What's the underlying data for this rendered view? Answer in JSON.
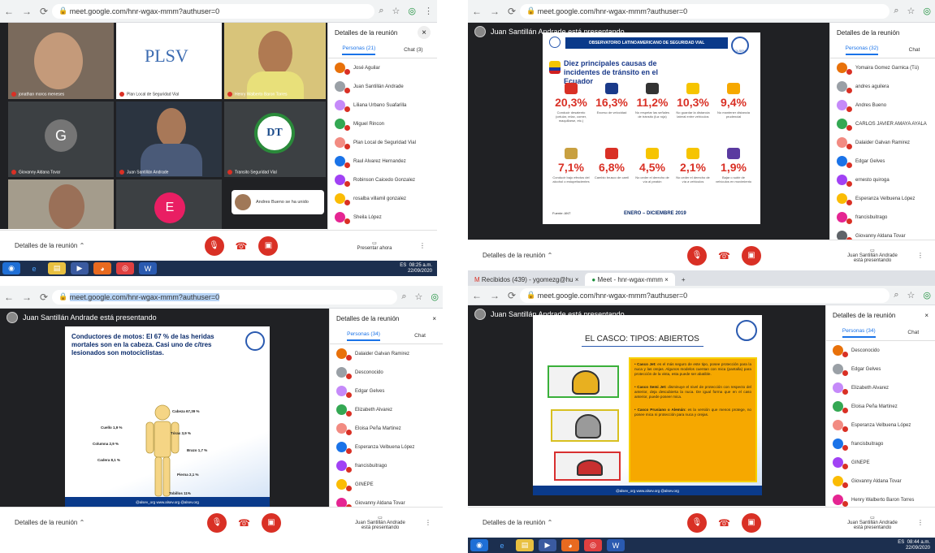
{
  "q1": {
    "url": "meet.google.com/hnr-wgax-mmm?authuser=0",
    "tiles": [
      "jonathan moros meneses",
      "Plan Local de Seguridad Vial",
      "Henry Walberto Baron Torres",
      "Giovanny Aldana Tovar",
      "Juan Santillán Andrade",
      "Transito Seguridad Vial"
    ],
    "plsv_logo": "PLSV",
    "g_letter": "G",
    "e_letter": "E",
    "dt_logo": "DT",
    "toast": "Andres Bueno se ha unido",
    "panel_title": "Detalles de la reunión",
    "people_tab": "Personas (21)",
    "chat_tab": "Chat (3)",
    "people": [
      "José Aguilar",
      "Juan Santillán Andrade",
      "Liliana Urbano Suafarilla",
      "Miguel Rincon",
      "Plan Local de Seguridad Vial",
      "Raul Alvarez Hernandez",
      "Robinson Caicedo Gonzalez",
      "rosalba villamil gonzalez",
      "Sheila López",
      "Transito Seguridad Vial"
    ],
    "meeting_details": "Detalles de la reunión",
    "present_label": "Presentar ahora",
    "lang": "ES",
    "time": "08:25 a.m.",
    "date": "22/09/2020"
  },
  "q2": {
    "url": "meet.google.com/hnr-wgax-mmm?authuser=0",
    "banner": "Juan Santillán Andrade está presentando",
    "slide_header": "OBSERVATORIO LATINOAMERICANO DE SEGURIDAD VIAL",
    "slide_title": "Diez principales causas de incidentes de tránsito en el Ecuador",
    "logo_text": "OLSEV",
    "percents_row1": [
      "20,3%",
      "16,3%",
      "11,2%",
      "10,3%",
      "9,4%"
    ],
    "captions_row1": [
      "Conducir desatento (celular, relax, comer, maquillarse, etc.)",
      "Exceso de velocidad",
      "No respetar las señales de tránsito (luz roja)",
      "No guardar la distancia lateral entre vehículos",
      "No mantener distancia prudencial"
    ],
    "percents_row2": [
      "7,1%",
      "6,8%",
      "4,5%",
      "2,1%",
      "1,9%"
    ],
    "captions_row2": [
      "Conducir bajo efectos del alcohol o estupefacientes",
      "Cambio brusco de carril",
      "No ceder el derecho de vía al peatón",
      "No ceder el derecho de vía a vehículos",
      "Bajar o subir de vehículos en movimiento"
    ],
    "source": "Fuente: ANT",
    "period": "ENERO – DICIEMBRE 2019",
    "panel_title": "Detalles de la reunión",
    "people_tab": "Personas (32)",
    "chat_tab": "Chat",
    "people": [
      "Yomaira Gomez Garnica (Tú)",
      "andres aguilera",
      "Andres Bueno",
      "CARLOS JAVIER AMAYA AYALA",
      "Dalaider Galvan Ramirez",
      "Edgar Gelves",
      "ernesto quiroga",
      "Esperanza Velbuena López",
      "francisbuitrago",
      "Giovanny Aldana Tovar"
    ],
    "meeting_details": "Detalles de la reunión",
    "presenting_label": "Juan Santillán Andrade está presentando"
  },
  "q3": {
    "url": "meet.google.com/hnr-wgax-mmm?authuser=0",
    "banner": "Juan Santillán Andrade está presentando",
    "slide_title": "Conductores de motos: El 67 % de las heridas mortales son en la cabeza. Casi uno de c/tres lesionados son motociclistas.",
    "body_labels": [
      "Cabeza 67,39 %",
      "Cuello 1,9 %",
      "Columna 2,9 %",
      "Tórax 3,9 %",
      "Brazo 1,7 %",
      "Cadera 8,1 %",
      "Pierna 2,1 %",
      "Tobillos 11%"
    ],
    "footer": "@alsev_org   www.alsev.org   @alsev.org",
    "panel_title": "Detalles de la reunión",
    "people_tab": "Personas (34)",
    "chat_tab": "Chat",
    "people": [
      "Dalaider Galvan Ramirez",
      "Desconocido",
      "Edgar Gelves",
      "Elizabeth Alvarez",
      "Eloisa Peña Martinez",
      "Esperanza Velbuena López",
      "francisbuitrago",
      "GINEPE",
      "Giovanny Aldana Tovar",
      "Henry Walberto Baron Torres"
    ],
    "meeting_details": "Detalles de la reunión",
    "presenting_label": "Juan Santillán Andrade está presentando"
  },
  "q4": {
    "tabs": [
      "Recibidos (439) - ygomezg@hu",
      "Meet - hnr-wgax-mmm"
    ],
    "url": "meet.google.com/hnr-wgax-mmm?authuser=0",
    "banner": "Juan Santillán Andrade está presentando",
    "slide_title": "EL CASCO: TIPOS: ABIERTOS",
    "bullets": [
      "Casco Jet: es el más seguro de este tipo, posee protección para la nuca y las orejas. Algunos modelos cuentan con mica (pantalla) para protección de la vista, esta puede ser abatible.",
      "Casco Semi Jet: disminuye el nivel de protección con respecto del anterior, deja descubierta la nuca. De igual forma que en el caso anterior, puede poseer mica.",
      "Casco Prusiano o Alemán: es la versión que menos protege, no posee mica ni protección para nuca y orejas."
    ],
    "footer": "@alsev_org   www.alsev.org   @alsev.org",
    "panel_title": "Detalles de la reunión",
    "people_tab": "Personas (34)",
    "chat_tab": "Chat",
    "people": [
      "Desconocido",
      "Edgar Gelves",
      "Elizabeth Alvarez",
      "Eloisa Peña Martinez",
      "Esperanza Velbuena López",
      "francisbuitrago",
      "GINEPE",
      "Giovanny Aldana Tovar",
      "Henry Walberto Baron Torres",
      "Herminda Hernandez"
    ],
    "meeting_details": "Detalles de la reunión",
    "presenting_label": "Juan Santillán Andrade está presentando",
    "lang": "ES",
    "time": "08:44 a.m.",
    "date": "22/09/2020"
  }
}
